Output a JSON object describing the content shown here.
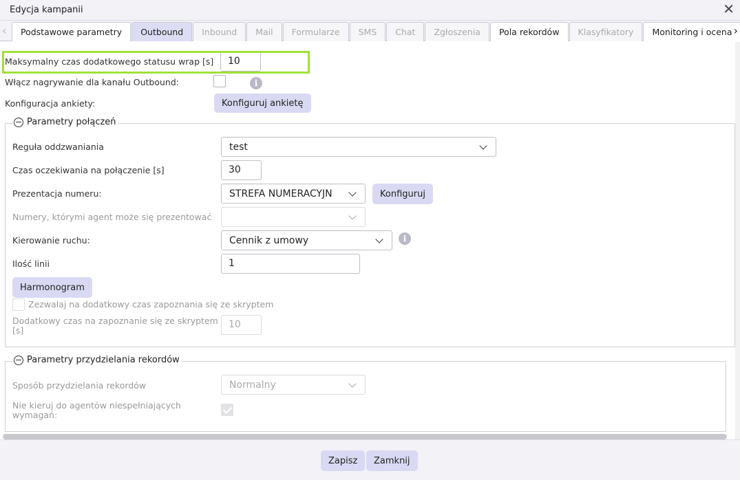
{
  "dialog": {
    "title": "Edycja kampanii"
  },
  "tabs": [
    {
      "label": "Podstawowe parametry",
      "state": "enabled"
    },
    {
      "label": "Outbound",
      "state": "active"
    },
    {
      "label": "Inbound",
      "state": "disabled"
    },
    {
      "label": "Mail",
      "state": "disabled"
    },
    {
      "label": "Formularze",
      "state": "disabled"
    },
    {
      "label": "SMS",
      "state": "disabled"
    },
    {
      "label": "Chat",
      "state": "disabled"
    },
    {
      "label": "Zgłoszenia",
      "state": "disabled"
    },
    {
      "label": "Pola rekordów",
      "state": "enabled"
    },
    {
      "label": "Klasyfikatory",
      "state": "disabled"
    },
    {
      "label": "Monitoring i ocena",
      "state": "enabled"
    }
  ],
  "general": {
    "wrap_label": "Maksymalny czas dodatkowego statusu wrap [s]",
    "wrap_value": "10",
    "recording_label": "Włącz nagrywanie dla kanału Outbound:",
    "survey_label": "Konfiguracja ankiety:",
    "survey_button": "Konfiguruj ankietę"
  },
  "connections": {
    "legend": "Parametry połączeń",
    "callback_label": "Reguła oddzwaniania",
    "callback_value": "test",
    "wait_label": "Czas oczekiwania na połączenie [s]",
    "wait_value": "30",
    "number_label": "Prezentacja numeru:",
    "number_value": "STREFA NUMERACYJN",
    "configure_button": "Konfiguruj",
    "agent_numbers_label": "Numery, którymi agent może się prezentować",
    "agent_numbers_value": "",
    "routing_label": "Kierowanie ruchu:",
    "routing_value": "Cennik z umowy",
    "lines_label": "Ilość linii",
    "lines_value": "1",
    "schedule_button": "Harmonogram",
    "script_time_label": "Zezwalaj na dodatkowy czas zapoznania się ze skryptem",
    "extra_time_label_1": "Dodatkowy czas na zapoznanie się ze skryptem",
    "extra_time_label_2": "[s]",
    "extra_time_value": "10"
  },
  "records": {
    "legend": "Parametry przydzielania rekordów",
    "method_label": "Sposób przydzielania rekordów",
    "method_value": "Normalny",
    "skip_label_1": "Nie kieruj do agentów niespełniających",
    "skip_label_2": "wymagań:"
  },
  "footer": {
    "save_label": "Zapisz",
    "close_label": "Zamknij"
  },
  "icons": {
    "close": "close-icon",
    "info": "info-icon",
    "chevron": "chevron-down-icon",
    "collapse": "collapse-icon"
  },
  "colors": {
    "highlight": "#9fe03a",
    "button_bg": "#d9d9f3",
    "active_tab": "#dcdcf4"
  }
}
